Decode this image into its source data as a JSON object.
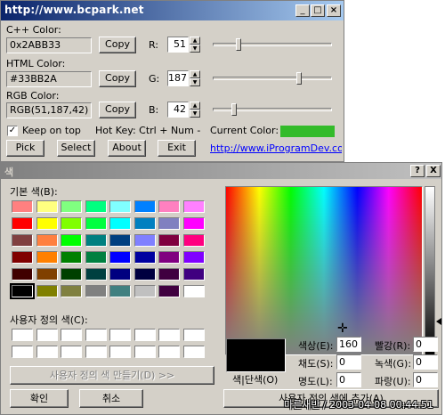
{
  "picker": {
    "title": "http://www.bcpark.net",
    "cpp_label": "C++ Color:",
    "cpp_value": "0x2ABB33",
    "html_label": "HTML Color:",
    "html_value": "#33BB2A",
    "rgb_label": "RGB Color:",
    "rgb_value": "RGB(51,187,42)",
    "copy_label": "Copy",
    "r_label": "R:",
    "g_label": "G:",
    "b_label": "B:",
    "r_value": "51",
    "g_value": "187",
    "b_value": "42",
    "r_level": 0.2,
    "g_level": 0.733,
    "b_level": 0.165,
    "keep_on_top": "Keep on top",
    "hotkey": "Hot Key: Ctrl + Num -",
    "current_color_label": "Current Color:",
    "current_color": "#33bb2a",
    "pick": "Pick",
    "select": "Select",
    "about": "About",
    "exit": "Exit",
    "link": "http://www.iProgramDev.co"
  },
  "dialog": {
    "title": "색",
    "help": "?",
    "close": "X",
    "basic_label": "기본 색(B):",
    "basic_colors": [
      [
        "#ff8080",
        "#ffff80",
        "#80ff80",
        "#00ff80",
        "#80ffff",
        "#0080ff",
        "#ff80c0",
        "#ff80ff"
      ],
      [
        "#ff0000",
        "#ffff00",
        "#80ff00",
        "#00ff40",
        "#00ffff",
        "#0080c0",
        "#8080c0",
        "#ff00ff"
      ],
      [
        "#804040",
        "#ff8040",
        "#00ff00",
        "#008080",
        "#004080",
        "#8080ff",
        "#800040",
        "#ff0080"
      ],
      [
        "#800000",
        "#ff8000",
        "#008000",
        "#008040",
        "#0000ff",
        "#0000a0",
        "#800080",
        "#8000ff"
      ],
      [
        "#400000",
        "#804000",
        "#004000",
        "#004040",
        "#000080",
        "#000040",
        "#400040",
        "#400080"
      ],
      [
        "#000000",
        "#808000",
        "#808040",
        "#808080",
        "#408080",
        "#c0c0c0",
        "#400040",
        "#ffffff"
      ]
    ],
    "custom_label": "사용자 정의 색(C):",
    "define_custom": "사용자 정의 색 만들기(D) >>",
    "ok": "확인",
    "cancel": "취소",
    "solid_label": "색|단색(O)",
    "hue_label": "색상(E):",
    "hue": "160",
    "sat_label": "채도(S):",
    "sat": "0",
    "lum_label": "명도(L):",
    "lum": "0",
    "red_label": "빨강(R):",
    "red": "0",
    "green_label": "녹색(G):",
    "green": "0",
    "blue_label": "파랑(U):",
    "blue": "0",
    "add_custom": "사용자 정의 색에 추가(A)",
    "watermark": "마른새반 / 2003-04-08 00:44:51"
  }
}
